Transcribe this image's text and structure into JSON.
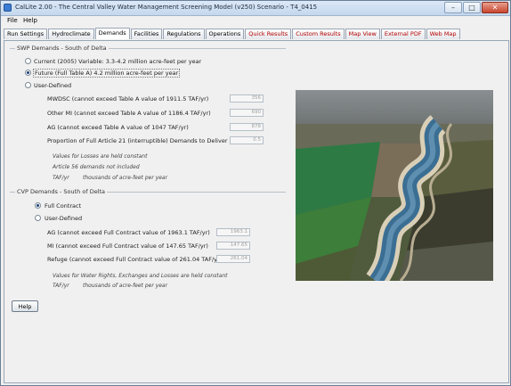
{
  "window": {
    "title": "CalLite 2.00 - The Central Valley Water Management Screening Model (v250) Scenario - T4_0415"
  },
  "menu": {
    "file": "File",
    "help": "Help"
  },
  "tabs": [
    {
      "label": "Run Settings"
    },
    {
      "label": "Hydroclimate"
    },
    {
      "label": "Demands"
    },
    {
      "label": "Facilities"
    },
    {
      "label": "Regulations"
    },
    {
      "label": "Operations"
    },
    {
      "label": "Quick Results"
    },
    {
      "label": "Custom Results"
    },
    {
      "label": "Map View"
    },
    {
      "label": "External PDF"
    },
    {
      "label": "Web Map"
    }
  ],
  "swp": {
    "title": "SWP Demands - South of Delta",
    "opt_current": "Current (2005) Variable: 3.3-4.2 million acre-feet per year",
    "opt_future": "Future (Full Table A) 4.2 million acre-feet per year",
    "opt_user": "User-Defined",
    "rows": [
      {
        "label": "MWDSC (cannot exceed Table A value of 1911.5 TAF/yr)",
        "value": "356"
      },
      {
        "label": "Other MI (cannot exceed Table A value of 1186.4 TAF/yr)",
        "value": "690"
      },
      {
        "label": "AG (cannot exceed Table A value of 1047 TAF/yr)",
        "value": "878"
      },
      {
        "label": "Proportion of Full Article 21 (interruptible) Demands to Deliver",
        "value": "0.5"
      }
    ],
    "note1": "Values for Losses are held constant",
    "note2": "Article 56 demands not included",
    "note3_key": "TAF/yr",
    "note3_val": "thousands of acre-feet per year"
  },
  "cvp": {
    "title": "CVP Demands - South of Delta",
    "opt_full": "Full Contract",
    "opt_user": "User-Defined",
    "rows": [
      {
        "label": "AG (cannot exceed Full Contract value of 1963.1 TAF/yr)",
        "value": "1963.1"
      },
      {
        "label": "MI (cannot exceed Full Contract value of 147.65 TAF/yr)",
        "value": "147.65"
      },
      {
        "label": "Refuge (cannot exceed Full Contract value of 261.04 TAF/yr)",
        "value": "261.04"
      }
    ],
    "note1": "Values for Water Rights, Exchanges and Losses are held constant",
    "note2_key": "TAF/yr",
    "note2_val": "thousands of acre-feet per year"
  },
  "help_button": "Help",
  "colors": {
    "tab_highlight": "#b40000",
    "titlebar": "#c4d8ee"
  },
  "icons": [
    "app-icon",
    "minimize-icon",
    "maximize-icon",
    "close-icon",
    "canal-aerial-photo"
  ]
}
